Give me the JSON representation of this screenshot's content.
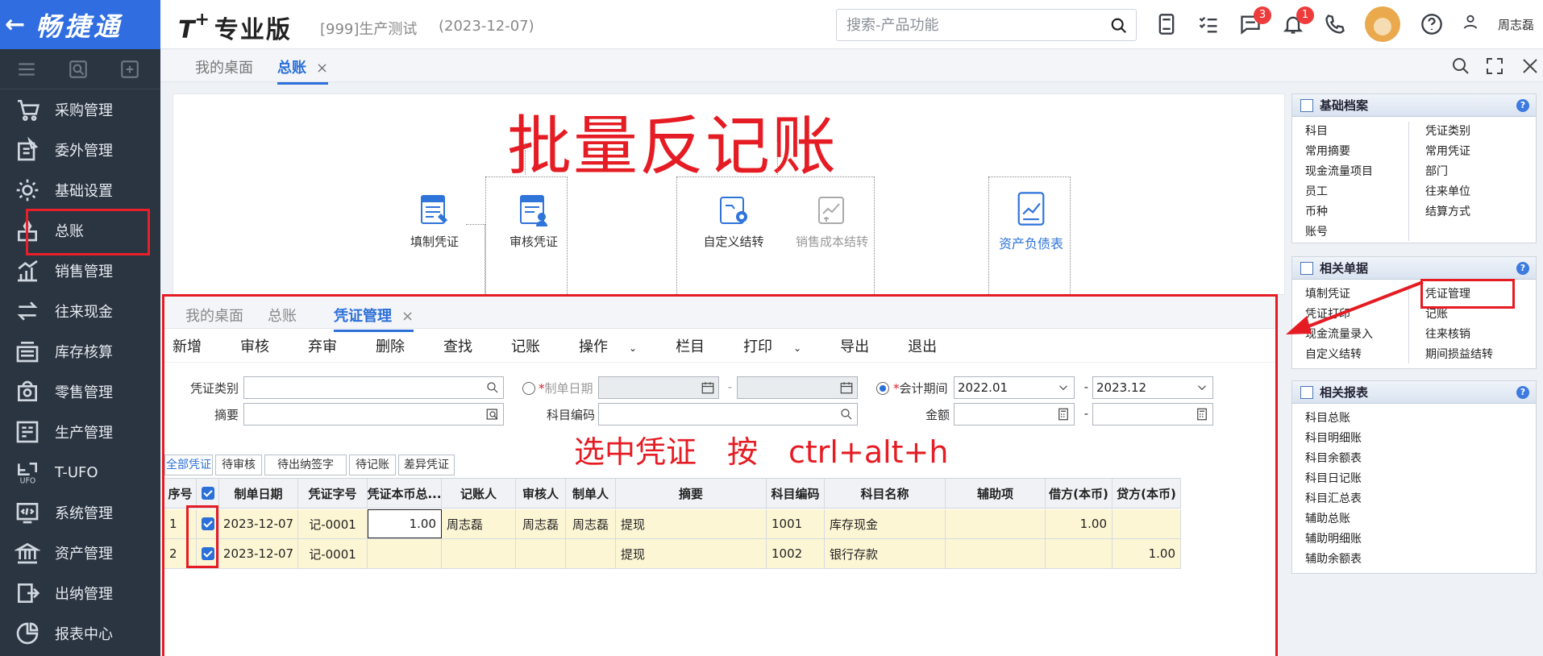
{
  "app": {
    "logo_back": "←",
    "logo_name": "畅捷通",
    "brand_t": "T",
    "brand_plus": "+",
    "brand_name": "专业版",
    "account": "[999]生产测试",
    "account_date": "(2023-12-07)",
    "search_placeholder": "搜索-产品功能",
    "badge_messages": "3",
    "badge_notifications": "1",
    "username": "周志磊"
  },
  "sidebar": {
    "items": [
      {
        "label": "采购管理",
        "icon": "cart-icon"
      },
      {
        "label": "委外管理",
        "icon": "outsource-icon"
      },
      {
        "label": "基础设置",
        "icon": "settings-icon"
      },
      {
        "label": "总账",
        "icon": "ledger-icon"
      },
      {
        "label": "销售管理",
        "icon": "sales-chart-icon"
      },
      {
        "label": "往来现金",
        "icon": "exchange-icon"
      },
      {
        "label": "库存核算",
        "icon": "inventory-icon"
      },
      {
        "label": "零售管理",
        "icon": "retail-icon"
      },
      {
        "label": "生产管理",
        "icon": "production-icon"
      },
      {
        "label": "T-UFO",
        "icon": "ufo-icon"
      },
      {
        "label": "系统管理",
        "icon": "system-icon"
      },
      {
        "label": "资产管理",
        "icon": "bank-icon"
      },
      {
        "label": "出纳管理",
        "icon": "cashier-icon"
      },
      {
        "label": "报表中心",
        "icon": "pie-chart-icon"
      }
    ]
  },
  "outer_tabs": {
    "desktop": "我的桌面",
    "ledger": "总账",
    "close": "×"
  },
  "flow": {
    "title": "批量反记账",
    "nodes": {
      "fill": "填制凭证",
      "audit": "审核凭证",
      "custom": "自定义结转",
      "cost": "销售成本结转",
      "balance": "资产负债表"
    },
    "icon_voucher_text": "凭证"
  },
  "basic_archive": {
    "title": "基础档案",
    "left": [
      "科目",
      "常用摘要",
      "现金流量项目",
      "员工",
      "币种",
      "账号"
    ],
    "right": [
      "凭证类别",
      "常用凭证",
      "部门",
      "往来单位",
      "结算方式"
    ]
  },
  "related_docs": {
    "title": "相关单据",
    "left": [
      "填制凭证",
      "凭证打印",
      "现金流量录入",
      "自定义结转"
    ],
    "right": [
      "凭证管理",
      "记账",
      "往来核销",
      "期间损益结转"
    ]
  },
  "related_reports": {
    "title": "相关报表",
    "items": [
      "科目总账",
      "科目明细账",
      "科目余额表",
      "科目日记账",
      "科目汇总表",
      "辅助总账",
      "辅助明细账",
      "辅助余额表"
    ]
  },
  "help_mark": "?",
  "inner": {
    "tabs": {
      "desktop": "我的桌面",
      "ledger": "总账",
      "voucher_mgmt": "凭证管理",
      "close": "×"
    },
    "toolbar": [
      "新增",
      "审核",
      "弃审",
      "删除",
      "查找",
      "记账",
      "操作",
      "栏目",
      "打印",
      "导出",
      "退出"
    ],
    "caret": "⌄",
    "filters": {
      "voucher_type_label": "凭证类别",
      "summary_label": "摘要",
      "make_date_label": "制单日期",
      "account_code_label": "科目编码",
      "period_label": "会计期间",
      "amount_label": "金额",
      "period_from": "2022.01",
      "period_to": "2023.12",
      "dash": "-",
      "required_mark": "*"
    },
    "hint": "选中凭证　按　ctrl+alt+h",
    "filter_tabs": [
      "全部凭证",
      "待审核",
      "待出纳签字",
      "待记账",
      "差异凭证"
    ],
    "columns": [
      "序号",
      "",
      "制单日期",
      "凭证字号",
      "凭证本币总...",
      "记账人",
      "审核人",
      "制单人",
      "摘要",
      "科目编码",
      "科目名称",
      "辅助项",
      "借方(本币)",
      "贷方(本币)"
    ],
    "rows": [
      {
        "no": "1",
        "date": "2023-12-07",
        "voucher_no": "记-0001",
        "total": "1.00",
        "poster": "周志磊",
        "auditor": "周志磊",
        "maker": "周志磊",
        "summary": "提现",
        "code": "1001",
        "name": "库存现金",
        "aux": "",
        "debit": "1.00",
        "credit": ""
      },
      {
        "no": "2",
        "date": "2023-12-07",
        "voucher_no": "记-0001",
        "total": "",
        "poster": "",
        "auditor": "",
        "maker": "",
        "summary": "提现",
        "code": "1002",
        "name": "银行存款",
        "aux": "",
        "debit": "",
        "credit": "1.00"
      }
    ]
  },
  "colors": {
    "accent": "#2b6fd8",
    "annotation_red": "#e51c23",
    "sidebar_bg": "#2b3441",
    "logo_bg": "#2f6de0",
    "row_highlight": "#fdf6d4"
  }
}
